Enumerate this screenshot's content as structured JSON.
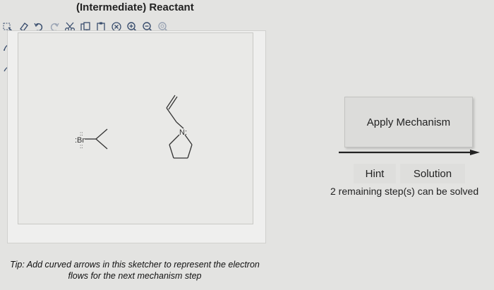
{
  "header": {
    "title": "(Intermediate) Reactant"
  },
  "toolbar": {
    "icons": [
      "select-icon",
      "erase-icon",
      "undo-icon",
      "redo-icon",
      "cut-icon",
      "copy-icon",
      "paste-icon",
      "clear-icon",
      "zoom-in-icon",
      "zoom-out-icon",
      "zoom-reset-icon"
    ]
  },
  "molecule_bromide": {
    "atom_label": ":Br",
    "lone_pairs": "::"
  },
  "molecule_amine": {
    "atom_label": "N:"
  },
  "tip": {
    "text": "Tip: Add curved arrows in this sketcher to represent the electron flows for the next mechanism step"
  },
  "actions": {
    "apply_label": "Apply Mechanism",
    "hint_label": "Hint",
    "solution_label": "Solution",
    "steps_text": "2 remaining step(s) can be solved"
  },
  "colors": {
    "background": "#e3e3e1",
    "canvas": "#e9e9e7",
    "toolbar_icon": "#3a4e6e",
    "arrow": "#222222"
  }
}
